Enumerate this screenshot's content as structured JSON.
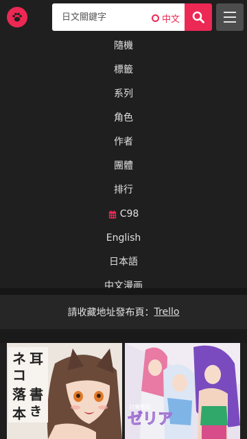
{
  "header": {
    "search": {
      "placeholder": "日文關鍵字"
    },
    "lang_toggle_label": "中文",
    "accent": "#ec2854"
  },
  "nav": {
    "items": [
      {
        "label": "隨機"
      },
      {
        "label": "標籤"
      },
      {
        "label": "系列"
      },
      {
        "label": "角色"
      },
      {
        "label": "作者"
      },
      {
        "label": "團體"
      },
      {
        "label": "排行"
      },
      {
        "label": "C98",
        "icon": "calendar-icon"
      },
      {
        "label": "English"
      },
      {
        "label": "日本語"
      },
      {
        "label": "中文漫画"
      }
    ]
  },
  "notice": {
    "text": "請收藏地址發布頁：",
    "link_label": "Trello"
  },
  "gallery": {
    "thumbnails": [
      {
        "cover_title_vertical": "ネコ耳落書き本"
      },
      {
        "cover_title": "ゼリア"
      }
    ]
  }
}
